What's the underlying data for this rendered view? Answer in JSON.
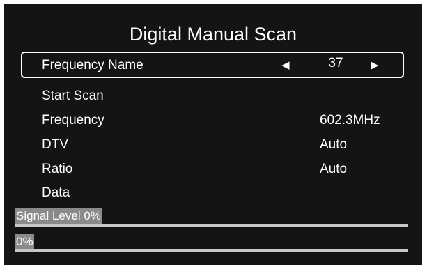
{
  "title": "Digital Manual Scan",
  "selector": {
    "label": "Frequency Name",
    "left_arrow": "◀",
    "value": "37",
    "right_arrow": "▶"
  },
  "items": [
    {
      "label": "Start Scan",
      "value": ""
    },
    {
      "label": "Frequency",
      "value": "602.3MHz"
    },
    {
      "label": "DTV",
      "value": "Auto"
    },
    {
      "label": "Ratio",
      "value": "Auto"
    },
    {
      "label": "Data",
      "value": ""
    }
  ],
  "signal": {
    "label": "Signal Level 0%",
    "level": 0
  },
  "progress": {
    "label": "0%",
    "level": 0
  }
}
